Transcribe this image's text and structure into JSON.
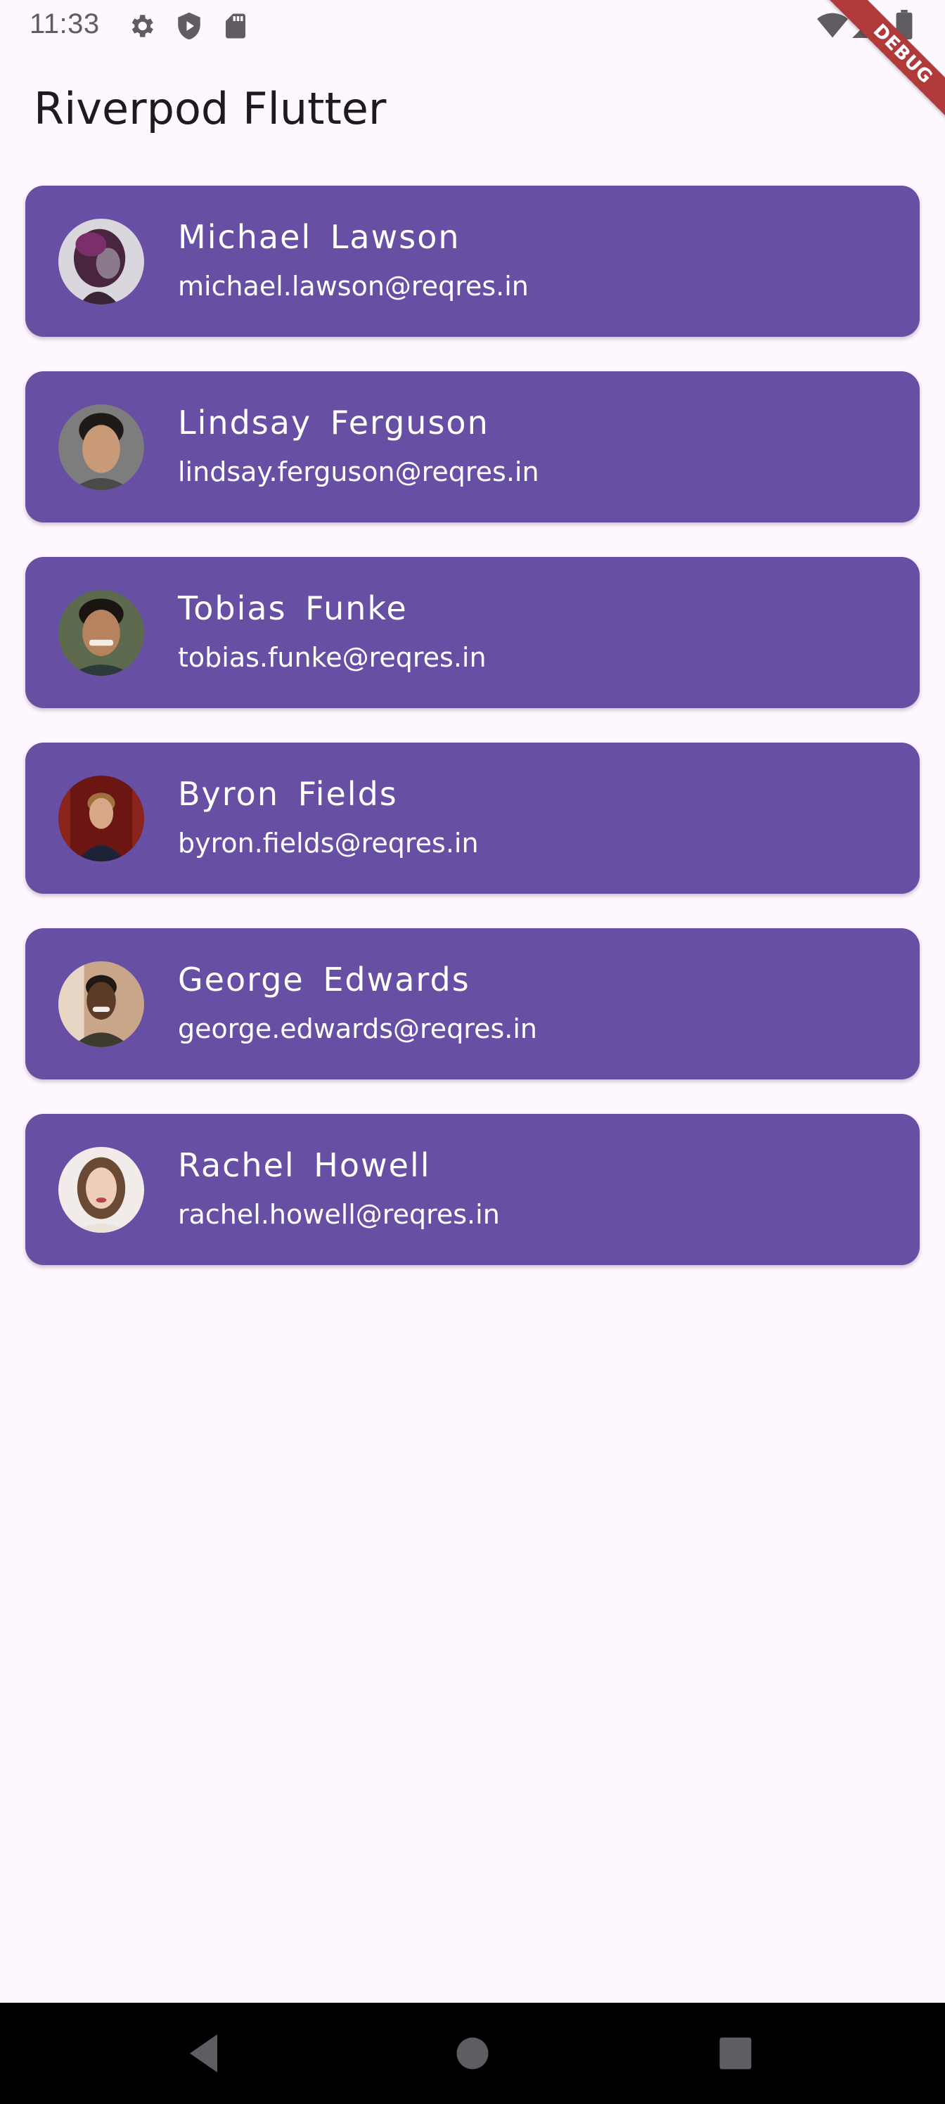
{
  "status_bar": {
    "time": "11:33",
    "icons": [
      "gear-icon",
      "shield-play-icon",
      "sd-card-icon",
      "wifi-icon",
      "signal-icon",
      "battery-icon"
    ]
  },
  "debug_banner": {
    "label": "DEBUG",
    "color": "#b03a3a"
  },
  "app_bar": {
    "title": "Riverpod Flutter"
  },
  "colors": {
    "background": "#FEF7FF",
    "card": "#6750A4",
    "card_text": "#FFFFFF",
    "title_text": "#1D1B20"
  },
  "users": [
    {
      "name": "Michael  Lawson",
      "email": "michael.lawson@reqres.in",
      "avatar": "avatar-photo"
    },
    {
      "name": "Lindsay  Ferguson",
      "email": "lindsay.ferguson@reqres.in",
      "avatar": "avatar-photo"
    },
    {
      "name": "Tobias  Funke",
      "email": "tobias.funke@reqres.in",
      "avatar": "avatar-photo"
    },
    {
      "name": "Byron  Fields",
      "email": "byron.fields@reqres.in",
      "avatar": "avatar-photo"
    },
    {
      "name": "George  Edwards",
      "email": "george.edwards@reqres.in",
      "avatar": "avatar-photo"
    },
    {
      "name": "Rachel  Howell",
      "email": "rachel.howell@reqres.in",
      "avatar": "avatar-photo"
    }
  ],
  "nav_bar": {
    "buttons": [
      "back-icon",
      "home-icon",
      "recents-icon"
    ]
  }
}
